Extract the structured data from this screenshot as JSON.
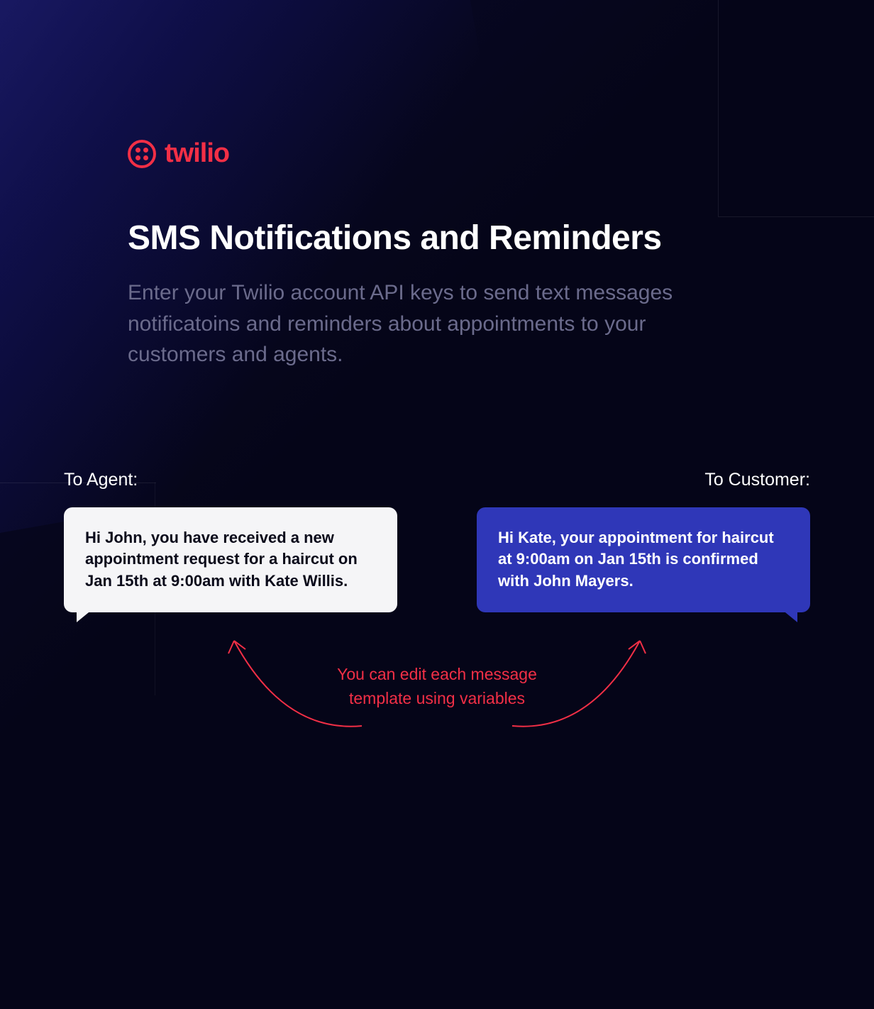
{
  "brand": {
    "name": "twilio",
    "color": "#f22f46"
  },
  "heading": "SMS Notifications and Reminders",
  "subheading": "Enter your Twilio account API keys to send text messages notificatoins and reminders about appointments to your customers and agents.",
  "bubbles": {
    "agent": {
      "label": "To Agent:",
      "message": "Hi John, you have received a new appointment request for a haircut on Jan 15th at 9:00am with Kate Willis."
    },
    "customer": {
      "label": "To Customer:",
      "message": "Hi Kate, your appointment for haircut at 9:00am on Jan 15th is confirmed with John Mayers."
    }
  },
  "annotation": "You can edit each message template using variables"
}
